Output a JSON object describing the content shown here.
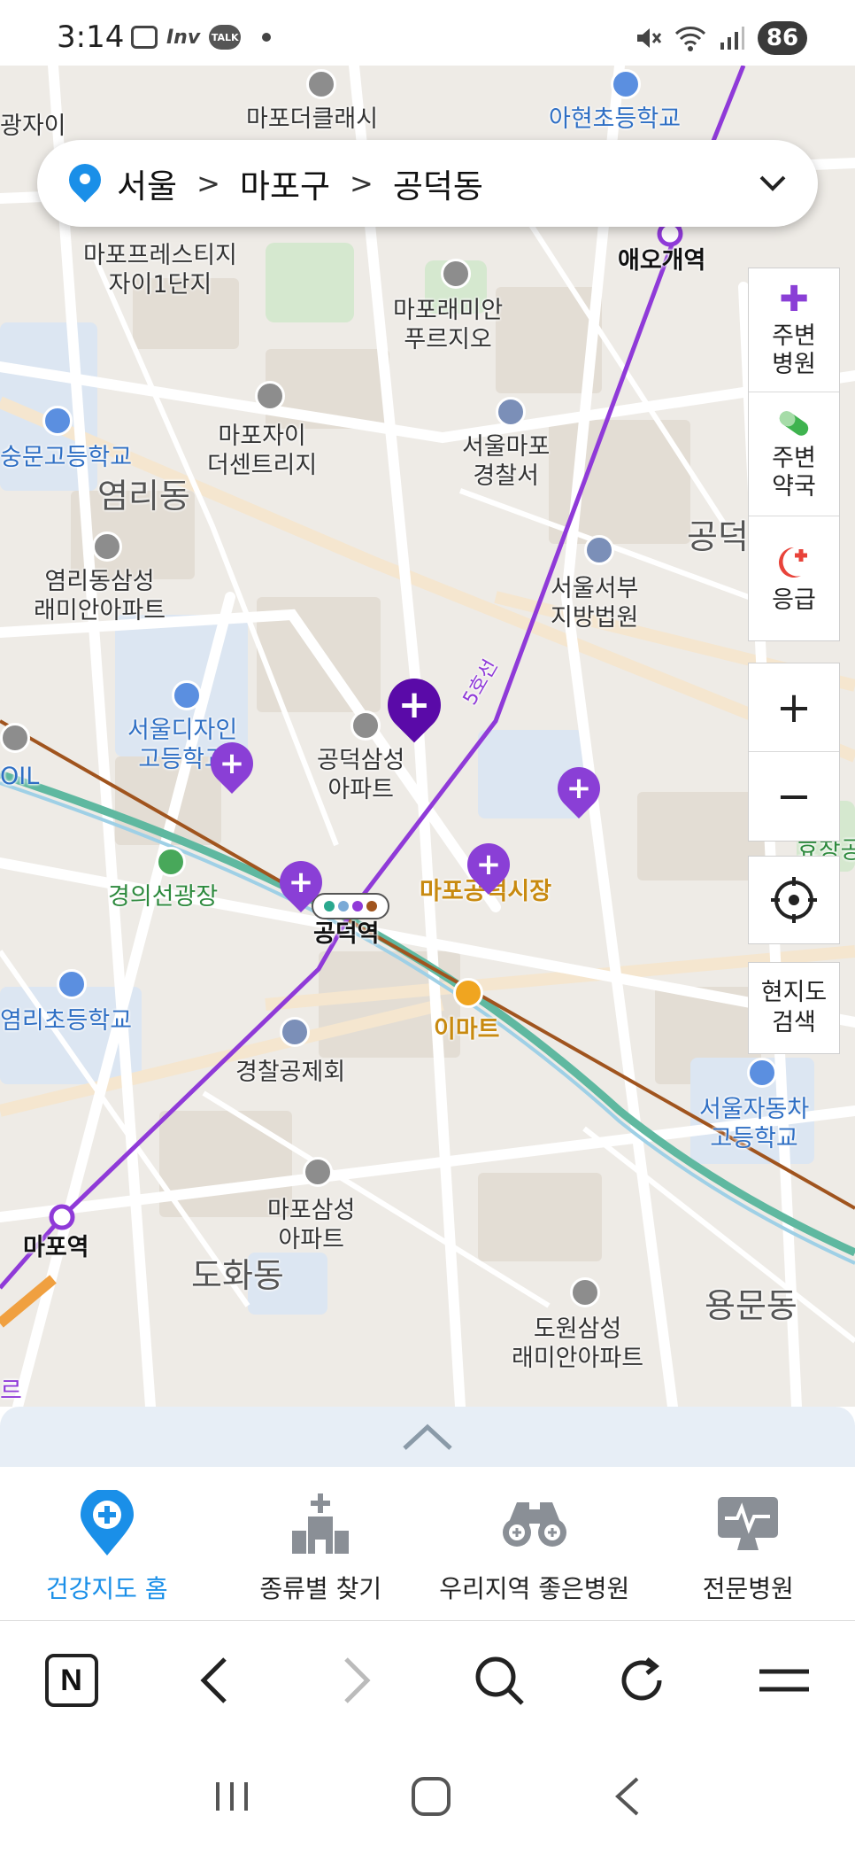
{
  "status_bar": {
    "time": "3:14",
    "inv_label": "Inv",
    "talk_label": "TALK",
    "battery": "86"
  },
  "location": {
    "city": "서울",
    "district": "마포구",
    "dong": "공덕동",
    "separator": ">",
    "dropdown_icon": "chevron-down-icon"
  },
  "map": {
    "labels": {
      "mapo_the_classy": "마포더클래시",
      "ahyeon_elem": "아현초등학교",
      "gwang_xi": "광자이",
      "mapo_prestige": "마포프레스티지\n자이1단지",
      "aeogae_station": "애오개역",
      "mapo_raemian": "마포래미안\n푸르지오",
      "mapo_xi_centreville": "마포자이\n더센트리지",
      "sungmun_high": "숭문고등학교",
      "seoul_mapo_police": "서울마포\n경찰서",
      "yeomni_dong": "염리동",
      "gongdeok_partial": "공덕",
      "yeomni_samsung": "염리동삼성\n래미안아파트",
      "seoul_west_court": "서울서부\n지방법원",
      "line5": "5호선",
      "seoul_design_high": "서울디자인\n고등학교",
      "gongdeok_samsung": "공덕삼성\n아파트",
      "oil": "OIL",
      "gyeongui_park": "경의선광장",
      "mapo_market": "마포공덕시장",
      "hyochang_partial": "효창공",
      "gongdeok_station": "공덕역",
      "yeomni_elem": "염리초등학교",
      "emart": "이마트",
      "police_mutual": "경찰공제회",
      "seoul_auto_high": "서울자동차\n고등학교",
      "mapo_samsung": "마포삼성\n아파트",
      "mapo_station": "마포역",
      "dohwa_dong": "도화동",
      "dowon_samsung": "도원삼성\n래미안아파트",
      "yongmun_dong": "용문동",
      "bottom_partial": "르"
    }
  },
  "controls": {
    "nearby_hospital": "주변\n병원",
    "nearby_pharmacy": "주변\n약국",
    "emergency": "응급",
    "zoom_in": "+",
    "zoom_out": "−",
    "search_here": "현지도\n검색"
  },
  "bottom_nav": {
    "items": [
      {
        "label": "건강지도 홈",
        "icon": "map-pin-plus-icon",
        "active": true
      },
      {
        "label": "종류별 찾기",
        "icon": "hospital-building-icon",
        "active": false
      },
      {
        "label": "우리지역 좋은병원",
        "icon": "binoculars-icon",
        "active": false
      },
      {
        "label": "전문병원",
        "icon": "monitor-pulse-icon",
        "active": false
      }
    ]
  },
  "browser_toolbar": {
    "home_label": "N"
  },
  "colors": {
    "accent_blue": "#1a8fe8",
    "hospital_purple": "#8a3fd6",
    "selected_purple": "#5a0aa8",
    "line5_purple": "#8f3ad8",
    "rail_brown": "#a0541e",
    "gyeongui_teal": "#5fb8a0"
  }
}
